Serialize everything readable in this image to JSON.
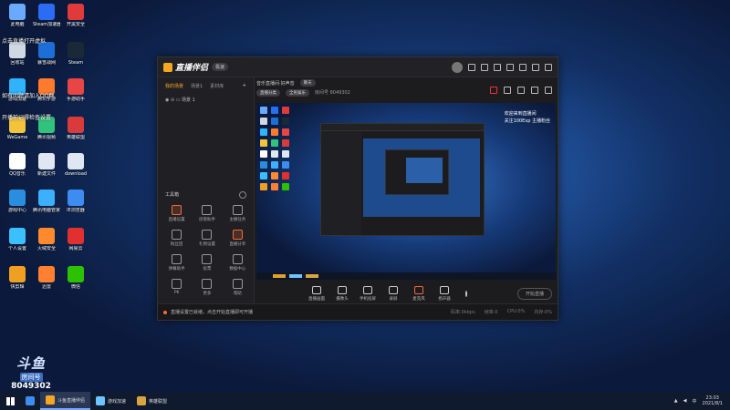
{
  "desktop_icons": [
    {
      "label": "此电脑",
      "color": "#6aa9ff",
      "icon": "computer-icon"
    },
    {
      "label": "Steam加速器",
      "color": "#2b6cf5",
      "icon": "steam-accelerator-icon"
    },
    {
      "label": "开黑安全",
      "color": "#e03a3a",
      "icon": "mascot-icon"
    },
    {
      "label": "回收站",
      "color": "#cfd8e3",
      "icon": "recycle-bin-icon"
    },
    {
      "label": "暴雪战网",
      "color": "#1d6fd8",
      "icon": "battlenet-icon"
    },
    {
      "label": "Steam",
      "color": "#1b2838",
      "icon": "steam-icon"
    },
    {
      "label": "游戏加速",
      "color": "#2fb3ff",
      "icon": "game-boost-icon"
    },
    {
      "label": "腾讯手游",
      "color": "#ff7a2d",
      "icon": "tencent-games-icon"
    },
    {
      "label": "手游助手",
      "color": "#e84545",
      "icon": "mobile-games-icon"
    },
    {
      "label": "WeGame",
      "color": "#f3c33c",
      "icon": "wegame-icon"
    },
    {
      "label": "腾讯视频",
      "color": "#31c27c",
      "icon": "video-icon"
    },
    {
      "label": "英雄联盟",
      "color": "#d93a3a",
      "icon": "lol-icon"
    },
    {
      "label": "QQ音乐",
      "color": "#ffffff",
      "icon": "qq-icon"
    },
    {
      "label": "新建文件",
      "color": "#dfe7f2",
      "icon": "file-icon"
    },
    {
      "label": "download",
      "color": "#dfe7f2",
      "icon": "document-icon"
    },
    {
      "label": "游戏中心",
      "color": "#2a8de0",
      "icon": "game-center-icon"
    },
    {
      "label": "腾讯电脑管家",
      "color": "#3ab0ff",
      "icon": "pc-manager-icon"
    },
    {
      "label": "IE浏览器",
      "color": "#3d8cf0",
      "icon": "ie-icon"
    },
    {
      "label": "个人设置",
      "color": "#3ac0ff",
      "icon": "settings-icon"
    },
    {
      "label": "火绒安全",
      "color": "#ff8a2d",
      "icon": "security-icon"
    },
    {
      "label": "网易云",
      "color": "#e23030",
      "icon": "music-icon"
    },
    {
      "label": "快剪辑",
      "color": "#f0a020",
      "icon": "film-icon"
    },
    {
      "label": "迅雷",
      "color": "#ff8030",
      "icon": "download-icon"
    },
    {
      "label": "微信",
      "color": "#2dc100",
      "icon": "wechat-icon"
    }
  ],
  "desktop_ghost_text": [
    "点击直播打开虚拟",
    "如有问题请加入QQ群",
    "开播前记得检查设置"
  ],
  "window": {
    "app_name": "直播伴侣",
    "badge": "极速",
    "left_tabs": [
      "我的场景",
      "场景1",
      "素材库"
    ],
    "scene_name": "场景 1",
    "tools_title": "工具箱",
    "tools": [
      {
        "label": "直播设置",
        "hot": true
      },
      {
        "label": "房管助手",
        "hot": false
      },
      {
        "label": "主播任务",
        "hot": false
      },
      {
        "label": "粉丝团",
        "hot": false
      },
      {
        "label": "礼物设置",
        "hot": false
      },
      {
        "label": "直播分享",
        "hot": true
      },
      {
        "label": "弹幕助手",
        "hot": false
      },
      {
        "label": "投票",
        "hot": false
      },
      {
        "label": "数据中心",
        "hot": false
      },
      {
        "label": "PK",
        "hot": false
      },
      {
        "label": "更多",
        "hot": false
      },
      {
        "label": "帮助",
        "hot": false
      }
    ],
    "stream_title": "音乐直播间·好声音",
    "stream_tag": "聊天",
    "stream_row2": [
      "直播分类",
      "全民娱乐",
      "房间号 8049302"
    ],
    "overlay_line1": "欢迎来到直播间",
    "overlay_line2": "关注100Exp 主播粉丝",
    "bottom_buttons": [
      {
        "label": "直播画面",
        "hot": false
      },
      {
        "label": "摄像头",
        "hot": false
      },
      {
        "label": "手机投屏",
        "hot": false
      },
      {
        "label": "录屏",
        "hot": false
      },
      {
        "label": "麦克风",
        "hot": true
      },
      {
        "label": "扬声器",
        "hot": false
      }
    ],
    "go_live": "开始直播",
    "status_text": "直播设置已就绪，点击开始直播即可开播",
    "status_stats": [
      "码率:0kbps",
      "帧率:0",
      "CPU:0%",
      "内存:0%"
    ]
  },
  "watermark": {
    "logo": "斗鱼",
    "tag": "房间号",
    "room": "8049302"
  },
  "taskbar": {
    "items": [
      {
        "label": "斗鱼直播伴侣",
        "color": "#f5a623",
        "active": true
      },
      {
        "label": "游戏加速",
        "color": "#6fc3ff",
        "active": false
      },
      {
        "label": "英雄联盟",
        "color": "#d9a441",
        "active": false
      }
    ],
    "time": "23:03",
    "date": "2021/8/1"
  }
}
